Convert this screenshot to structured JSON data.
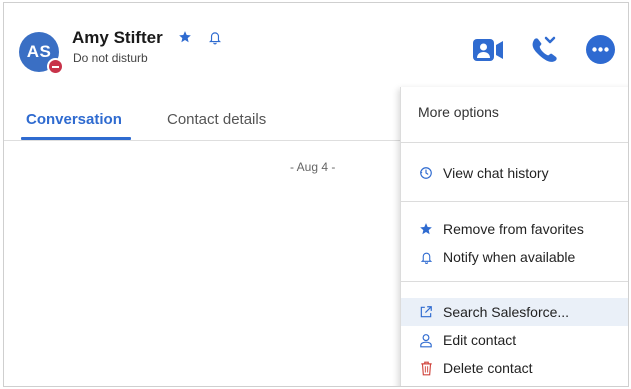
{
  "contact": {
    "initials": "AS",
    "name": "Amy Stifter",
    "status": "Do not disturb"
  },
  "tabs": [
    {
      "label": "Conversation",
      "active": true
    },
    {
      "label": "Contact details",
      "active": false
    }
  ],
  "conversation": {
    "date_separator": "- Aug 4 -"
  },
  "menu": {
    "title": "More options",
    "items": [
      {
        "label": "View chat history",
        "icon": "history-icon"
      },
      {
        "label": "Remove from favorites",
        "icon": "star-icon"
      },
      {
        "label": "Notify when available",
        "icon": "bell-icon"
      },
      {
        "label": "Search Salesforce...",
        "icon": "external-link-icon"
      },
      {
        "label": "Edit contact",
        "icon": "person-icon"
      },
      {
        "label": "Delete contact",
        "icon": "trash-icon"
      }
    ]
  },
  "colors": {
    "accent": "#2f6bd0",
    "avatar": "#3a6fc4",
    "dnd": "#c8334a",
    "delete": "#d0453d"
  }
}
